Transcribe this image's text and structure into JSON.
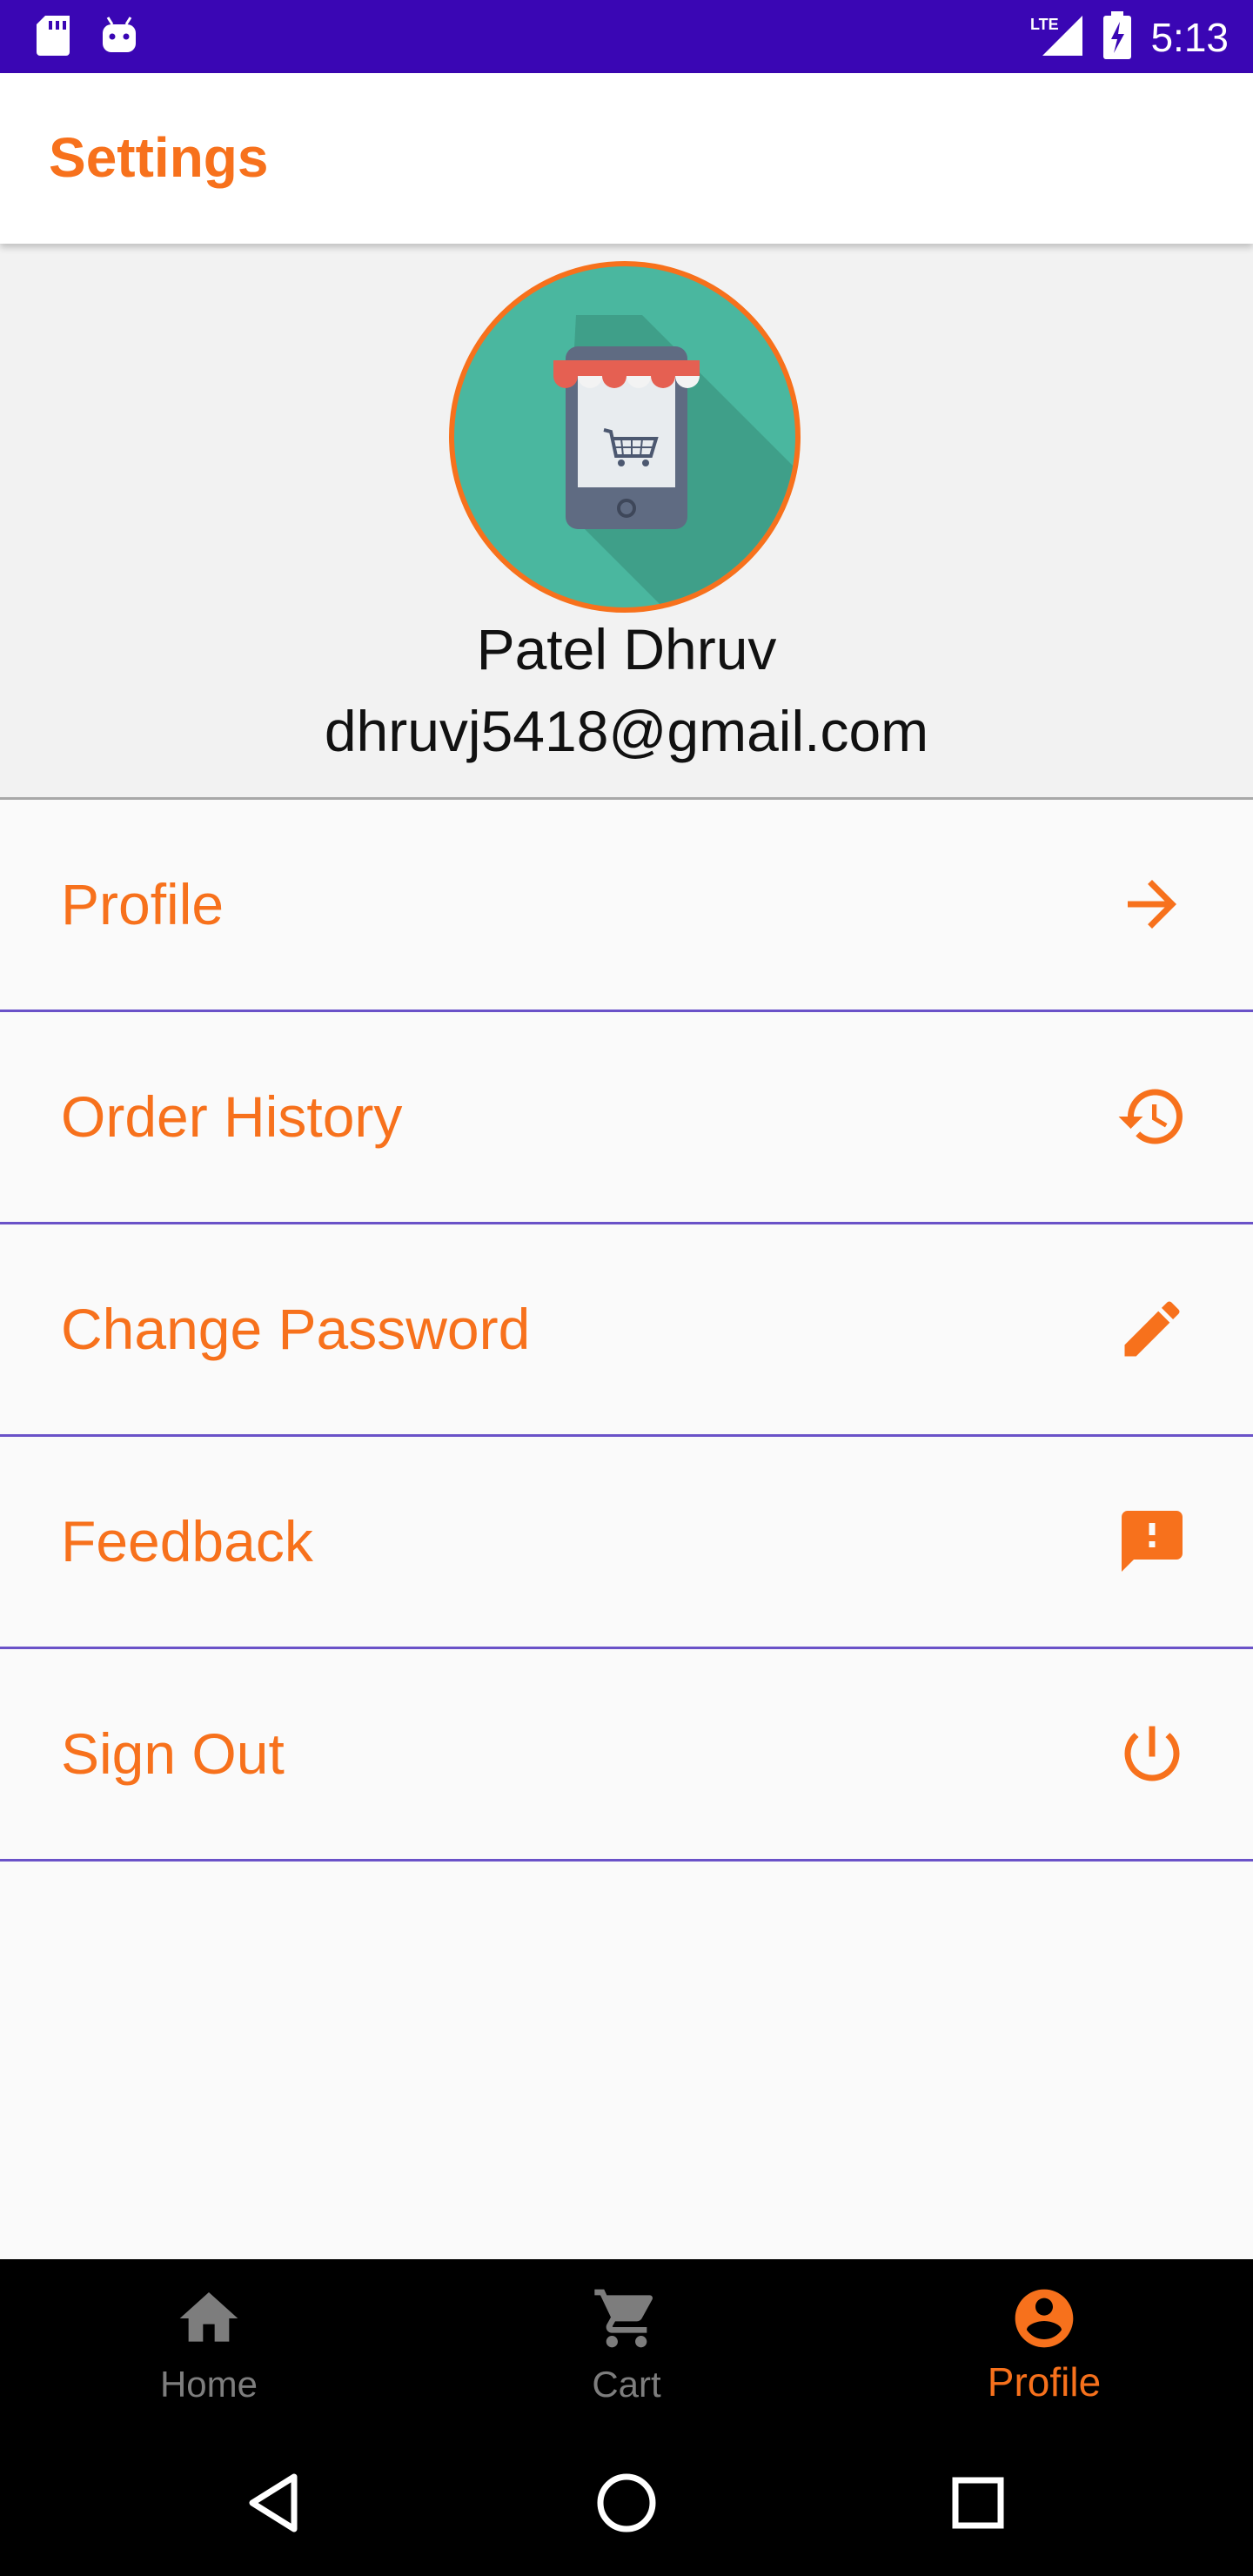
{
  "status_bar": {
    "time": "5:13",
    "network": "LTE",
    "icons": [
      "sd-card-icon",
      "android-icon",
      "lte-signal-icon",
      "battery-charging-icon"
    ]
  },
  "app_bar": {
    "title": "Settings"
  },
  "profile_header": {
    "avatar_icon": "shop-cart-phone-icon",
    "name": "Patel Dhruv",
    "email": "dhruvj5418@gmail.com"
  },
  "menu": {
    "items": [
      {
        "label": "Profile",
        "icon": "arrow-right-icon"
      },
      {
        "label": "Order History",
        "icon": "history-icon"
      },
      {
        "label": "Change Password",
        "icon": "pencil-icon"
      },
      {
        "label": "Feedback",
        "icon": "feedback-icon"
      },
      {
        "label": "Sign Out",
        "icon": "power-icon"
      }
    ]
  },
  "bottom_nav": {
    "items": [
      {
        "label": "Home",
        "icon": "home-icon",
        "active": false
      },
      {
        "label": "Cart",
        "icon": "cart-icon",
        "active": false
      },
      {
        "label": "Profile",
        "icon": "account-circle-icon",
        "active": true
      }
    ]
  },
  "system_nav": {
    "icons": [
      "back-icon",
      "home-circle-icon",
      "recents-icon"
    ]
  },
  "colors": {
    "accent": "#f7711c",
    "status_bar": "#3a06b4",
    "divider": "#6a52c8",
    "avatar_bg": "#4ab79f"
  }
}
